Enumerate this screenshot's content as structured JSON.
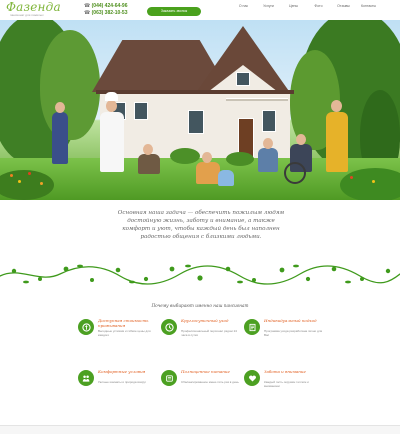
{
  "header": {
    "logo": "Фазенда",
    "logo_sub": "пансионат для пожилых",
    "phone1": "(044) 424-64-96",
    "phone2": "(063) 382-10-53",
    "cta_label": "Заказать звонок",
    "nav": [
      "О нас",
      "Услуги",
      "Цены",
      "Фото",
      "Отзывы",
      "Контакты"
    ]
  },
  "slogan_lines": [
    "Основная наша задача — обеспечить пожилым людям",
    "достойную жизнь, заботу и внимание, а также",
    "комфорт и уют, чтобы каждый день был наполнен",
    "радостью общения с близкими людьми."
  ],
  "features_title": "Почему выбирают именно наш пансионат",
  "features": [
    {
      "icon": "price-icon",
      "head": "Доступная стоимость проживания",
      "body": "Выгодные условия и гибкие цены для каждого"
    },
    {
      "icon": "clock-icon",
      "head": "Круглосуточный уход",
      "body": "Профессиональный персонал рядом 24 часа в сутки"
    },
    {
      "icon": "document-icon",
      "head": "Индивидуальный подход",
      "body": "Программа ухода разработана лично для Вас"
    },
    {
      "icon": "people-icon",
      "head": "Комфортные условия",
      "body": "Уютные комнаты и природа вокруг"
    },
    {
      "icon": "food-icon",
      "head": "Полноценное питание",
      "body": "Сбалансированное меню пять раз в день"
    },
    {
      "icon": "heart-icon",
      "head": "Забота и внимание",
      "body": "Каждый гость окружён теплом и вниманием"
    }
  ],
  "colors": {
    "brand_green": "#4aa11d",
    "accent_orange": "#e05a1a"
  }
}
